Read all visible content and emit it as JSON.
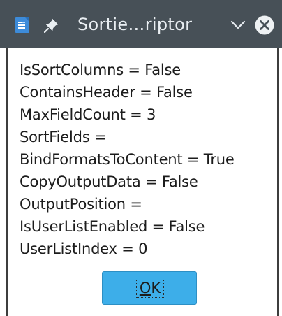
{
  "window": {
    "title": "Sortie…riptor"
  },
  "properties": [
    "IsSortColumns = False",
    "ContainsHeader = False",
    "MaxFieldCount = 3",
    "SortFields =",
    "BindFormatsToContent = True",
    "CopyOutputData = False",
    "OutputPosition =",
    "IsUserListEnabled = False",
    "UserListIndex = 0"
  ],
  "ok_button": {
    "mnemonic": "O",
    "rest": "K"
  },
  "icons": {
    "app": "document-app-icon",
    "pin": "pin-icon",
    "minimize": "chevron-down-icon",
    "close": "close-icon"
  },
  "colors": {
    "titlebar": "#475057",
    "title_text": "#e9eef2",
    "button_accent": "#3daee9",
    "background": "#ffffff",
    "text": "#1c1c1c"
  }
}
